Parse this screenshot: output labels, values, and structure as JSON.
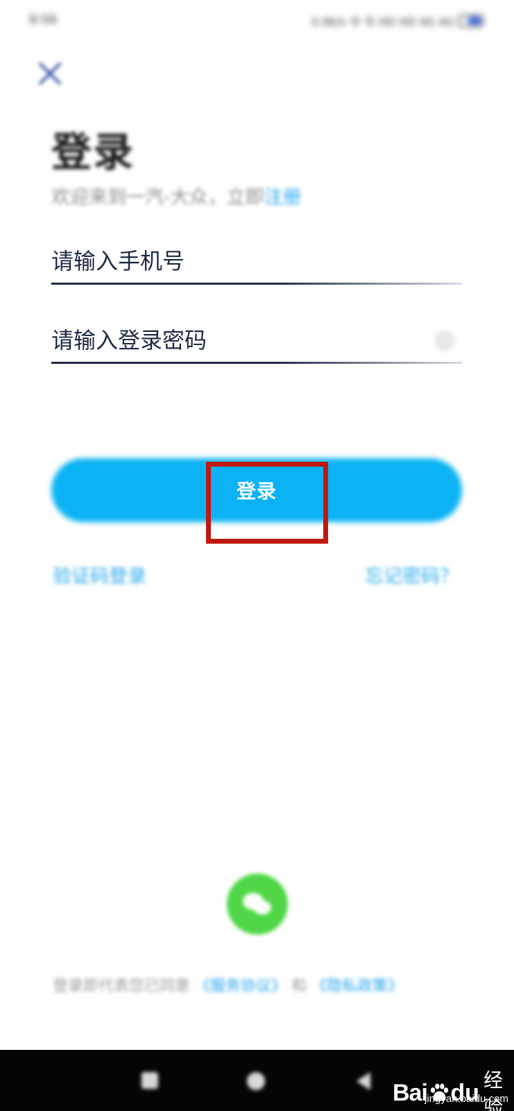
{
  "status_bar": {
    "time": "8:56",
    "indicators": "0.9K/s 令 令 HD HD 4G 4G",
    "battery_color": "#2a5adf"
  },
  "header": {
    "close_icon": "close-icon"
  },
  "title": "登录",
  "subtitle": {
    "text": "欢迎来到一汽-大众，立即",
    "register_link": "注册"
  },
  "form": {
    "phone_placeholder": "请输入手机号",
    "password_placeholder": "请输入登录密码",
    "password_toggle_icon": "eye-icon"
  },
  "login_button": {
    "label": "登录",
    "color": "#0bb3f4"
  },
  "links": {
    "sms_login": "验证码登录",
    "forgot_password": "忘记密码？"
  },
  "social": {
    "wechat_icon": "wechat-icon",
    "wechat_color": "#4fd646"
  },
  "agreement": {
    "prefix": "登录即代表您已同意",
    "terms": "《服务协议》",
    "and": "和",
    "privacy": "《隐私政策》"
  },
  "highlight_color": "#c0170f",
  "watermark": {
    "bai": "Bai",
    "du": "du",
    "jingyan": "经验",
    "url": "jingyan.baidu.com"
  }
}
